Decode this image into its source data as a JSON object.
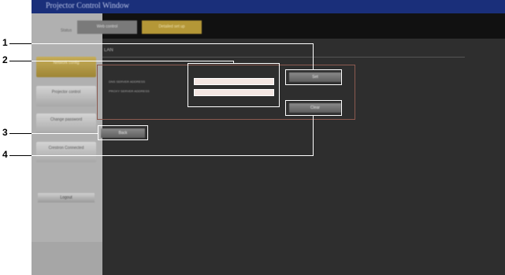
{
  "window": {
    "title": "Projector Control Window"
  },
  "sidebar": {
    "items": [
      {
        "label": "Status"
      },
      {
        "label": "Network config"
      },
      {
        "label": "Projector control"
      },
      {
        "label": "Change password"
      },
      {
        "label": "Crestron Connected"
      }
    ],
    "logout_label": "Logout"
  },
  "topbar": {
    "buttons": [
      {
        "label": "Web control"
      },
      {
        "label": "Detailed set up"
      }
    ]
  },
  "main": {
    "heading": "LAN",
    "fields": [
      {
        "label": "DNS SERVER ADDRESS",
        "value": ""
      },
      {
        "label": "PROXY SERVER ADDRESS",
        "value": ""
      }
    ],
    "buttons": {
      "set": "Set",
      "clear": "Clear",
      "back": "Back"
    }
  },
  "callouts": [
    "1",
    "2",
    "3",
    "4"
  ]
}
